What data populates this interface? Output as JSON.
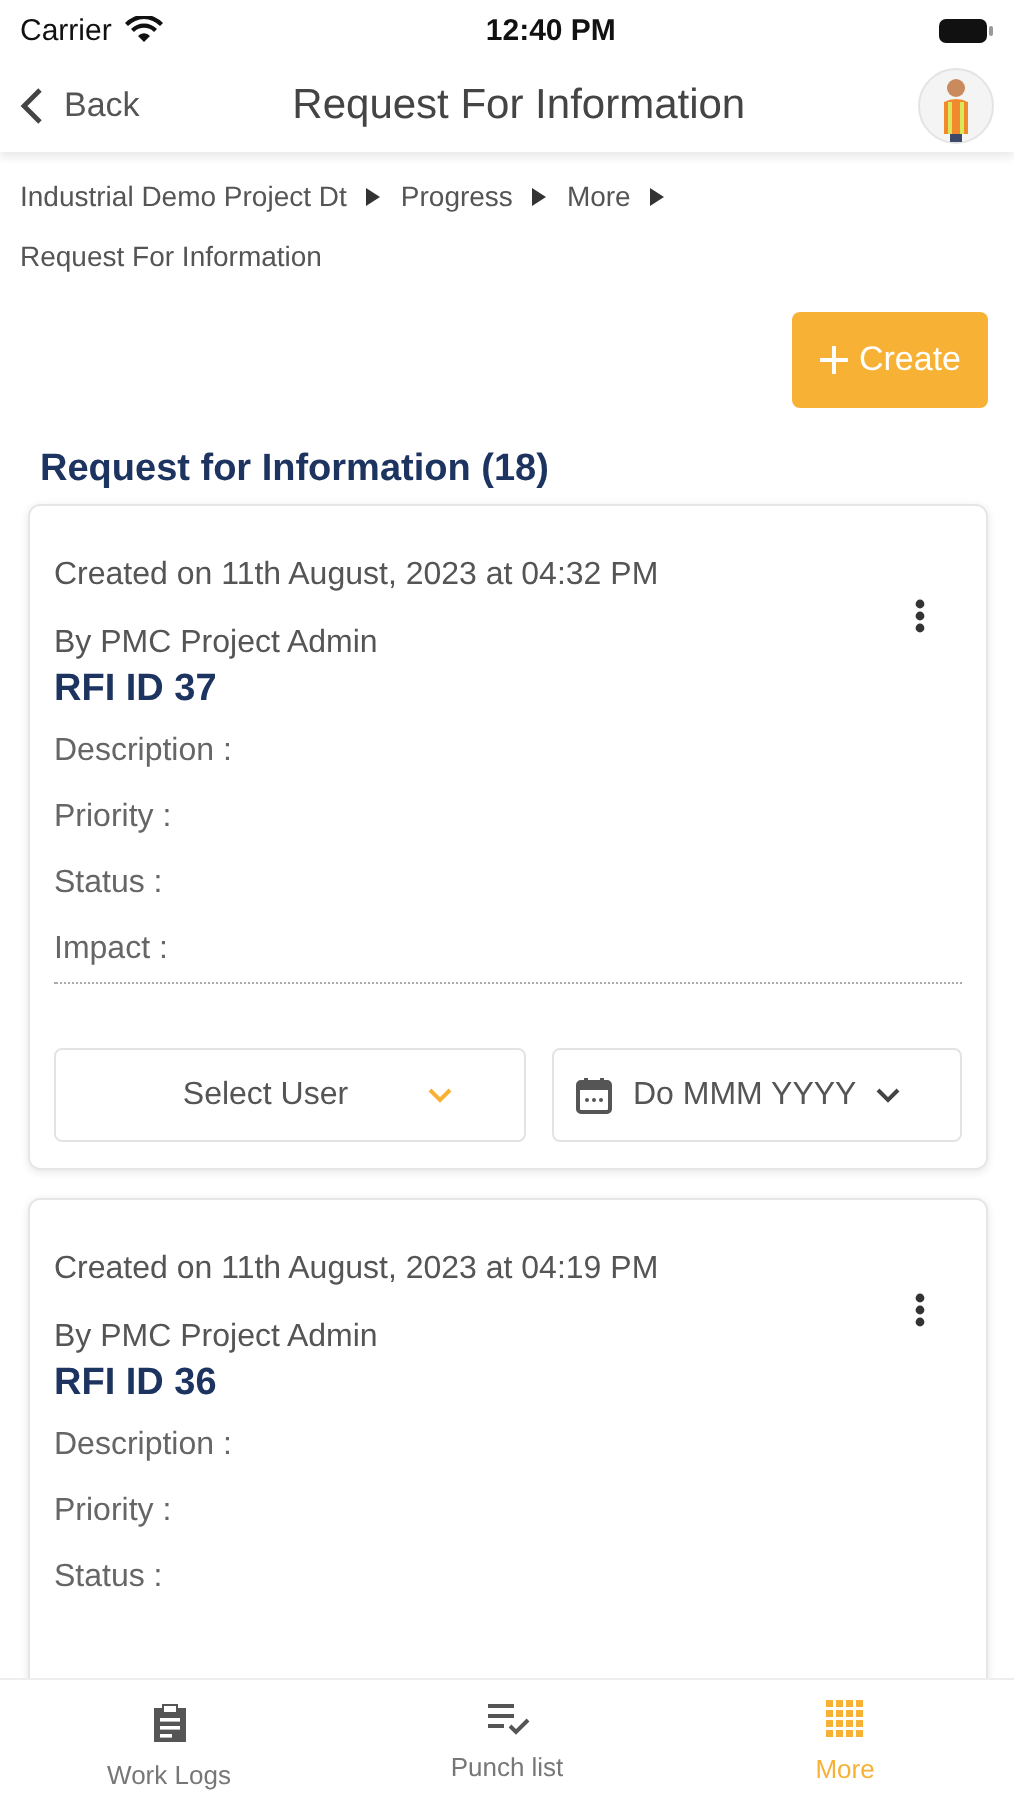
{
  "status_bar": {
    "carrier": "Carrier",
    "time": "12:40 PM"
  },
  "nav": {
    "back": "Back",
    "title": "Request For Information"
  },
  "breadcrumb": [
    {
      "label": "Industrial Demo Project Dt"
    },
    {
      "label": "Progress"
    },
    {
      "label": "More"
    },
    {
      "label": "Request For Information"
    }
  ],
  "create_button": "Create",
  "list_title": "Request for Information (18)",
  "rfis": [
    {
      "created": "Created on 11th August, 2023 at 04:32 PM",
      "by": "By PMC Project Admin",
      "rfi_id": "RFI ID 37",
      "fields": [
        "Description :",
        "Priority :",
        "Status :",
        "Impact :"
      ],
      "user_select": "Select User",
      "date_select": "Do MMM YYYY"
    },
    {
      "created": "Created on 11th August, 2023 at 04:19 PM",
      "by": "By PMC Project Admin",
      "rfi_id": "RFI ID 36",
      "fields": [
        "Description :",
        "Priority :",
        "Status :"
      ]
    }
  ],
  "tabs": [
    {
      "label": "Work Logs",
      "kind": "clipboard",
      "selected": false
    },
    {
      "label": "Punch list",
      "kind": "checklist",
      "selected": false
    },
    {
      "label": "More",
      "kind": "grid",
      "selected": true
    }
  ]
}
